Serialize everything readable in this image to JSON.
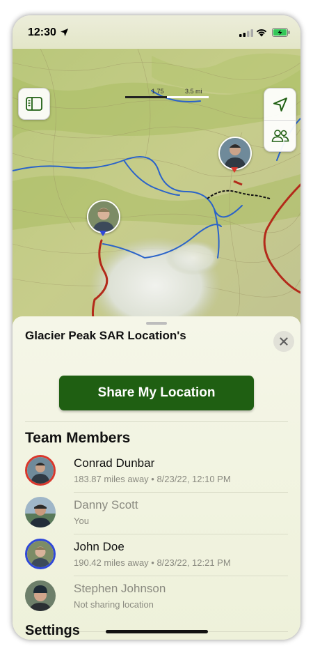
{
  "status_bar": {
    "time": "12:30",
    "icons": [
      "location-arrow-icon",
      "cellular-signal-icon",
      "wifi-icon",
      "battery-charging-icon"
    ]
  },
  "map": {
    "scale": {
      "label_a": "1.75",
      "label_b": "3.5 mi"
    },
    "buttons": [
      "sidebar-toggle-icon",
      "location-arrow-icon",
      "people-icon"
    ],
    "pins": [
      {
        "member": "Conrad Dunbar",
        "color": "#d9372c"
      },
      {
        "member": "John Doe",
        "color": "#2f48d8"
      }
    ]
  },
  "sheet": {
    "title": "Glacier Peak SAR Location's",
    "close_icon": "close-icon",
    "share_button": "Share My Location",
    "team_title": "Team Members",
    "members": [
      {
        "name": "Conrad Dunbar",
        "detail": "183.87 miles away • 8/23/22, 12:10 PM",
        "ring": "#d9372c",
        "active": true
      },
      {
        "name": "Danny Scott",
        "detail": "You",
        "ring": "",
        "active": false
      },
      {
        "name": "John Doe",
        "detail": "190.42 miles away • 8/23/22, 12:21 PM",
        "ring": "#2f48d8",
        "active": true
      },
      {
        "name": "Stephen Johnson",
        "detail": "Not sharing location",
        "ring": "",
        "active": false
      }
    ],
    "settings_title": "Settings"
  },
  "colors": {
    "accent_green": "#1f5f12",
    "trail_red": "#b32a1a",
    "river_blue": "#2a63c9"
  }
}
